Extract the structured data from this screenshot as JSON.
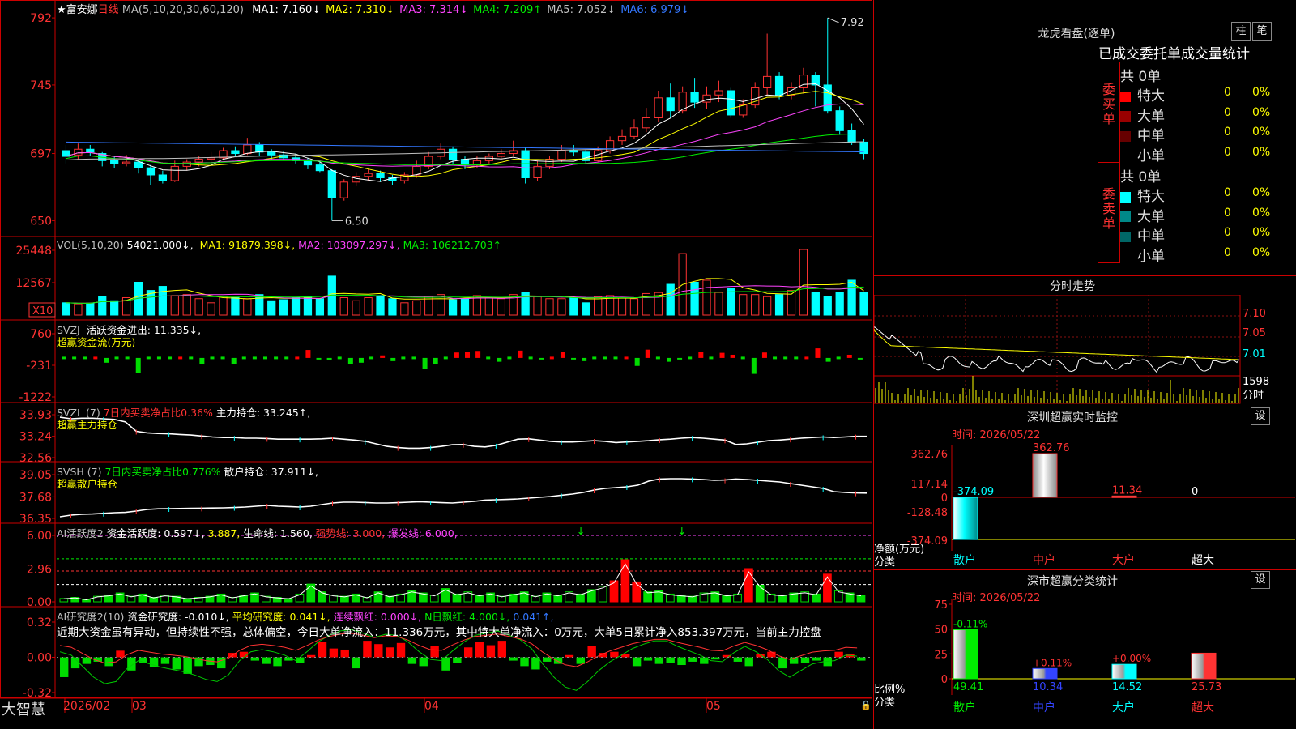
{
  "stock": {
    "name": "★富安娜",
    "period": "日线"
  },
  "colors": {
    "up": "#ff3333",
    "down": "#00ffff",
    "bg": "#000000",
    "frame": "#cc0000"
  },
  "main": {
    "ma_title": "MA(5,10,20,30,60,120)",
    "ma": [
      {
        "label": "MA1: 7.160↓",
        "color": "#ffffff"
      },
      {
        "label": "MA2: 7.310↓",
        "color": "#ffff00"
      },
      {
        "label": "MA3: 7.314↓",
        "color": "#ff44ff"
      },
      {
        "label": "MA4: 7.209↑",
        "color": "#00ee00"
      },
      {
        "label": "MA5: 7.052↓",
        "color": "#c0c0c0"
      },
      {
        "label": "MA6: 6.979↓",
        "color": "#3377ff"
      }
    ],
    "y_ticks": [
      "792",
      "745",
      "697",
      "650"
    ],
    "high_label": "7.92",
    "low_label": "6.50"
  },
  "candles": [
    {
      "o": 6.99,
      "c": 6.95,
      "h": 7.03,
      "l": 6.9
    },
    {
      "o": 6.96,
      "c": 7.0,
      "h": 7.04,
      "l": 6.93
    },
    {
      "o": 7.0,
      "c": 6.98,
      "h": 7.03,
      "l": 6.95
    },
    {
      "o": 6.97,
      "c": 6.92,
      "h": 6.98,
      "l": 6.88
    },
    {
      "o": 6.92,
      "c": 6.9,
      "h": 6.95,
      "l": 6.87
    },
    {
      "o": 6.9,
      "c": 6.91,
      "h": 6.96,
      "l": 6.88
    },
    {
      "o": 6.91,
      "c": 6.87,
      "h": 6.93,
      "l": 6.83
    },
    {
      "o": 6.87,
      "c": 6.82,
      "h": 6.89,
      "l": 6.75
    },
    {
      "o": 6.82,
      "c": 6.78,
      "h": 6.85,
      "l": 6.76
    },
    {
      "o": 6.78,
      "c": 6.88,
      "h": 6.92,
      "l": 6.77
    },
    {
      "o": 6.88,
      "c": 6.91,
      "h": 6.93,
      "l": 6.85
    },
    {
      "o": 6.91,
      "c": 6.93,
      "h": 6.95,
      "l": 6.88
    },
    {
      "o": 6.93,
      "c": 6.94,
      "h": 6.98,
      "l": 6.9
    },
    {
      "o": 6.94,
      "c": 6.99,
      "h": 7.01,
      "l": 6.93
    },
    {
      "o": 6.99,
      "c": 6.97,
      "h": 7.02,
      "l": 6.95
    },
    {
      "o": 6.97,
      "c": 7.03,
      "h": 7.08,
      "l": 6.96
    },
    {
      "o": 7.03,
      "c": 6.98,
      "h": 7.05,
      "l": 6.95
    },
    {
      "o": 6.98,
      "c": 6.96,
      "h": 7.0,
      "l": 6.93
    },
    {
      "o": 6.96,
      "c": 6.94,
      "h": 6.99,
      "l": 6.92
    },
    {
      "o": 6.94,
      "c": 6.92,
      "h": 6.97,
      "l": 6.9
    },
    {
      "o": 6.92,
      "c": 6.89,
      "h": 6.94,
      "l": 6.86
    },
    {
      "o": 6.89,
      "c": 6.85,
      "h": 6.91,
      "l": 6.84
    },
    {
      "o": 6.85,
      "c": 6.66,
      "h": 6.86,
      "l": 6.5
    },
    {
      "o": 6.66,
      "c": 6.77,
      "h": 6.79,
      "l": 6.64
    },
    {
      "o": 6.77,
      "c": 6.81,
      "h": 6.84,
      "l": 6.74
    },
    {
      "o": 6.81,
      "c": 6.83,
      "h": 6.86,
      "l": 6.78
    },
    {
      "o": 6.83,
      "c": 6.8,
      "h": 6.85,
      "l": 6.77
    },
    {
      "o": 6.8,
      "c": 6.78,
      "h": 6.82,
      "l": 6.75
    },
    {
      "o": 6.78,
      "c": 6.82,
      "h": 6.84,
      "l": 6.76
    },
    {
      "o": 6.82,
      "c": 6.88,
      "h": 6.92,
      "l": 6.8
    },
    {
      "o": 6.88,
      "c": 6.95,
      "h": 6.98,
      "l": 6.86
    },
    {
      "o": 6.95,
      "c": 7.0,
      "h": 7.04,
      "l": 6.93
    },
    {
      "o": 7.0,
      "c": 6.93,
      "h": 7.02,
      "l": 6.9
    },
    {
      "o": 6.93,
      "c": 6.89,
      "h": 6.95,
      "l": 6.86
    },
    {
      "o": 6.89,
      "c": 6.92,
      "h": 6.95,
      "l": 6.87
    },
    {
      "o": 6.92,
      "c": 6.95,
      "h": 6.97,
      "l": 6.9
    },
    {
      "o": 6.95,
      "c": 6.97,
      "h": 7.0,
      "l": 6.93
    },
    {
      "o": 6.97,
      "c": 6.99,
      "h": 7.06,
      "l": 6.95
    },
    {
      "o": 6.99,
      "c": 6.8,
      "h": 7.01,
      "l": 6.76
    },
    {
      "o": 6.8,
      "c": 6.88,
      "h": 6.92,
      "l": 6.78
    },
    {
      "o": 6.88,
      "c": 6.93,
      "h": 6.95,
      "l": 6.86
    },
    {
      "o": 6.93,
      "c": 6.99,
      "h": 7.03,
      "l": 6.91
    },
    {
      "o": 6.99,
      "c": 6.98,
      "h": 7.03,
      "l": 6.95
    },
    {
      "o": 6.98,
      "c": 6.92,
      "h": 7.0,
      "l": 6.9
    },
    {
      "o": 6.92,
      "c": 6.99,
      "h": 7.02,
      "l": 6.91
    },
    {
      "o": 6.99,
      "c": 7.06,
      "h": 7.09,
      "l": 6.97
    },
    {
      "o": 7.06,
      "c": 7.09,
      "h": 7.14,
      "l": 7.03
    },
    {
      "o": 7.09,
      "c": 7.15,
      "h": 7.21,
      "l": 7.07
    },
    {
      "o": 7.15,
      "c": 7.22,
      "h": 7.29,
      "l": 7.12
    },
    {
      "o": 7.22,
      "c": 7.36,
      "h": 7.41,
      "l": 7.19
    },
    {
      "o": 7.36,
      "c": 7.27,
      "h": 7.46,
      "l": 7.22
    },
    {
      "o": 7.27,
      "c": 7.4,
      "h": 7.44,
      "l": 7.25
    },
    {
      "o": 7.4,
      "c": 7.33,
      "h": 7.5,
      "l": 7.29
    },
    {
      "o": 7.33,
      "c": 7.38,
      "h": 7.44,
      "l": 7.28
    },
    {
      "o": 7.38,
      "c": 7.41,
      "h": 7.48,
      "l": 7.33
    },
    {
      "o": 7.41,
      "c": 7.24,
      "h": 7.43,
      "l": 7.22
    },
    {
      "o": 7.24,
      "c": 7.31,
      "h": 7.35,
      "l": 7.22
    },
    {
      "o": 7.31,
      "c": 7.43,
      "h": 7.47,
      "l": 7.29
    },
    {
      "o": 7.43,
      "c": 7.51,
      "h": 7.81,
      "l": 7.38
    },
    {
      "o": 7.51,
      "c": 7.38,
      "h": 7.54,
      "l": 7.35
    },
    {
      "o": 7.38,
      "c": 7.43,
      "h": 7.47,
      "l": 7.35
    },
    {
      "o": 7.43,
      "c": 7.52,
      "h": 7.57,
      "l": 7.39
    },
    {
      "o": 7.52,
      "c": 7.45,
      "h": 7.54,
      "l": 7.3
    },
    {
      "o": 7.45,
      "c": 7.27,
      "h": 7.92,
      "l": 7.25
    },
    {
      "o": 7.27,
      "c": 7.13,
      "h": 7.3,
      "l": 7.1
    },
    {
      "o": 7.13,
      "c": 7.05,
      "h": 7.18,
      "l": 7.03
    },
    {
      "o": 7.05,
      "c": 6.97,
      "h": 7.07,
      "l": 6.93
    }
  ],
  "vol": {
    "title": "VOL(5,10,20)",
    "cur": "54021.000↓,",
    "ma": [
      {
        "label": "MA1: 91879.398↓,",
        "color": "#ffff00"
      },
      {
        "label": "MA2: 103097.297↓,",
        "color": "#ff44ff"
      },
      {
        "label": "MA3: 106212.703↑",
        "color": "#00ee00"
      }
    ],
    "y_ticks": [
      "25448",
      "12567"
    ],
    "unit": "X10",
    "values": [
      60,
      55,
      58,
      90,
      70,
      85,
      160,
      120,
      140,
      95,
      100,
      80,
      60,
      90,
      85,
      80,
      100,
      70,
      75,
      85,
      90,
      80,
      190,
      85,
      70,
      85,
      95,
      80,
      60,
      70,
      90,
      100,
      75,
      80,
      95,
      85,
      80,
      100,
      110,
      90,
      80,
      80,
      85,
      60,
      90,
      95,
      85,
      80,
      105,
      110,
      150,
      300,
      160,
      170,
      110,
      130,
      100,
      100,
      90,
      100,
      120,
      320,
      110,
      90,
      110,
      170,
      110,
      95,
      80,
      70
    ]
  },
  "svzj": {
    "title": "SVZJ",
    "line1": "活跃资金进出: 11.335↓,",
    "line2": "超赢资金流(万元)",
    "y_ticks": [
      "760",
      "-231",
      "-1222"
    ],
    "values": [
      -30,
      -20,
      -40,
      20,
      -150,
      -20,
      -30,
      -480,
      -20,
      -30,
      -40,
      10,
      -30,
      -200,
      -20,
      -30,
      -180,
      -20,
      -30,
      -20,
      -40,
      -20,
      20,
      250,
      -50,
      -60,
      -20,
      -200,
      -150,
      -30,
      80,
      -100,
      -40,
      -30,
      -350,
      -200,
      -30,
      170,
      180,
      220,
      -30,
      -120,
      -40,
      230,
      -30,
      -50,
      40,
      190,
      -50,
      -100,
      -30,
      -40,
      -20,
      40,
      -250,
      260,
      -30,
      -120,
      -50,
      -30,
      180,
      -30,
      160,
      100,
      -30,
      -500,
      170,
      -30,
      -40,
      -20,
      30,
      300,
      -120,
      -10,
      100,
      -50
    ]
  },
  "svzl": {
    "title": "SVZL (7)",
    "ratio": "7日内买卖净占比0.36%",
    "hold": "主力持仓: 33.245↑,",
    "line2": "超赢主力持仓",
    "y_ticks": [
      "33.93",
      "33.24",
      "32.56"
    ],
    "values": [
      33.85,
      33.8,
      33.82,
      33.82,
      33.8,
      33.78,
      33.7,
      33.4,
      33.35,
      33.33,
      33.32,
      33.3,
      33.28,
      33.25,
      33.22,
      33.2,
      33.2,
      33.18,
      33.18,
      33.17,
      33.15,
      33.15,
      33.15,
      33.15,
      33.16,
      33.18,
      33.15,
      33.12,
      33.08,
      33.0,
      32.92,
      32.88,
      32.86,
      32.86,
      32.88,
      32.92,
      32.97,
      32.98,
      32.92,
      32.9,
      32.95,
      33.05,
      33.15,
      33.16,
      33.12,
      33.08,
      33.06,
      33.06,
      33.08,
      33.1,
      33.08,
      33.04,
      33.06,
      33.08,
      33.1,
      33.13,
      33.15,
      33.18,
      33.2,
      33.18,
      33.15,
      33.12,
      32.98,
      33.0,
      33.05,
      33.1,
      33.12,
      33.15,
      33.18,
      33.2,
      33.22,
      33.2,
      33.22,
      33.24,
      33.24
    ]
  },
  "svsh": {
    "title": "SVSH (7)",
    "ratio": "7日内买卖净占比0.776%",
    "hold": "散户持仓: 37.911↓,",
    "line2": "超赢散户持仓",
    "y_ticks": [
      "39.05",
      "37.68",
      "36.35"
    ],
    "values": [
      36.45,
      36.55,
      36.6,
      36.62,
      36.66,
      36.7,
      36.72,
      36.8,
      36.9,
      36.94,
      36.95,
      36.96,
      36.97,
      36.98,
      36.99,
      37.0,
      37.02,
      37.05,
      37.1,
      37.15,
      37.1,
      37.08,
      37.05,
      37.1,
      37.2,
      37.3,
      37.35,
      37.35,
      37.33,
      37.3,
      37.3,
      37.32,
      37.35,
      37.38,
      37.35,
      37.32,
      37.3,
      37.35,
      37.4,
      37.48,
      37.5,
      37.52,
      37.55,
      37.6,
      37.65,
      37.7,
      37.78,
      37.85,
      37.95,
      38.1,
      38.2,
      38.25,
      38.3,
      38.4,
      38.65,
      38.78,
      38.8,
      38.8,
      38.78,
      38.75,
      38.7,
      38.72,
      38.78,
      38.75,
      38.7,
      38.65,
      38.6,
      38.5,
      38.4,
      38.3,
      38.2,
      38.0,
      37.95,
      37.92,
      37.91
    ]
  },
  "ai1": {
    "title": "AI活跃度2",
    "a": "资金活跃度: 0.597↓,",
    "b": "3.887,",
    "c": "生命线: 1.560,",
    "d": "强势线: 3.000,",
    "e": "爆发线: 6.000,",
    "y_ticks": [
      "6.00",
      "2.96",
      "0.00"
    ],
    "values": [
      0.3,
      0.4,
      0.2,
      0.5,
      0.6,
      0.8,
      0.5,
      0.7,
      0.4,
      0.6,
      0.5,
      0.3,
      0.4,
      0.5,
      0.7,
      0.4,
      0.6,
      0.8,
      0.5,
      0.4,
      0.3,
      0.7,
      1.6,
      0.9,
      0.6,
      0.5,
      0.7,
      0.4,
      0.9,
      0.5,
      0.7,
      1.0,
      0.8,
      0.6,
      1.2,
      0.7,
      0.9,
      0.6,
      0.8,
      0.5,
      0.7,
      0.9,
      0.5,
      0.8,
      0.6,
      0.9,
      0.7,
      1.1,
      1.4,
      1.9,
      3.8,
      1.8,
      0.9,
      1.0,
      0.7,
      0.6,
      0.5,
      0.8,
      0.9,
      0.6,
      0.7,
      3.0,
      1.5,
      0.7,
      0.6,
      0.8,
      0.9,
      0.7,
      2.5,
      1.0,
      0.8,
      0.6
    ],
    "arrows": [
      46,
      55
    ]
  },
  "ai2": {
    "title": "AI研究度2(10)",
    "a": "资金研究度: -0.010↓,",
    "b": "平均研究度: 0.041↓,",
    "c": "连续飘红: 0.000↓,",
    "d": "N日飘红: 4.000↓,",
    "e": "0.041↑,",
    "comment": "近期大资金虽有异动，但持续性不强，总体偏空，今日大单净流入：11.336万元，其中特大单净流入：0万元，大单5日累计净入853.397万元，当前主力控盘",
    "y_ticks": [
      "0.32",
      "0.00",
      "-0.32"
    ],
    "values": [
      -0.18,
      -0.1,
      -0.06,
      -0.04,
      -0.08,
      0.06,
      -0.12,
      -0.05,
      -0.09,
      -0.06,
      -0.11,
      -0.15,
      -0.08,
      -0.07,
      -0.1,
      0.04,
      0.05,
      -0.03,
      -0.06,
      -0.08,
      -0.03,
      -0.05,
      0.02,
      0.14,
      0.08,
      0.07,
      -0.1,
      0.15,
      0.12,
      0.09,
      0.13,
      -0.06,
      -0.08,
      0.1,
      -0.12,
      -0.05,
      0.09,
      0.14,
      0.11,
      0.15,
      -0.03,
      -0.08,
      -0.11,
      -0.04,
      -0.06,
      0.02,
      -0.06,
      0.1,
      0.04,
      0.05,
      0.03,
      -0.08,
      -0.03,
      -0.06,
      -0.05,
      -0.07,
      -0.04,
      -0.06,
      -0.02,
      0.02,
      -0.04,
      -0.08,
      0.03,
      0.05,
      -0.1,
      -0.06,
      -0.05,
      -0.03,
      -0.08,
      0.05,
      0.03,
      -0.03
    ],
    "line": [
      0.05,
      0.02,
      -0.08,
      -0.18,
      -0.24,
      -0.22,
      -0.1,
      -0.03,
      -0.06,
      -0.09,
      -0.11,
      -0.13,
      -0.16,
      -0.2,
      -0.22,
      -0.16,
      -0.03,
      0.05,
      0.07,
      0.05,
      0.02,
      -0.03,
      0.05,
      0.14,
      0.2,
      0.24,
      0.25,
      0.22,
      0.18,
      0.21,
      0.2,
      0.14,
      0.05,
      -0.02,
      -0.03,
      0.06,
      0.14,
      0.2,
      0.22,
      0.24,
      0.2,
      0.16,
      0.08,
      -0.06,
      -0.18,
      -0.27,
      -0.3,
      -0.22,
      -0.12,
      -0.04,
      0.02,
      0.08,
      0.12,
      0.15,
      0.15,
      0.1,
      0.06,
      0.02,
      -0.03,
      -0.04,
      0.04,
      0.1,
      0.05,
      -0.02,
      -0.12,
      -0.18,
      -0.12,
      -0.06,
      -0.04,
      -0.03,
      0.02,
      0.01
    ]
  },
  "bottom": {
    "brand": "大智慧",
    "dates": [
      "2026/02",
      "03",
      "04",
      "05"
    ]
  },
  "side": {
    "lhb_title": "龙虎看盘(逐单)",
    "btn_col": "柱",
    "btn_pen": "笔",
    "stat_title": "已成交委托单成交量统计",
    "buy_group": "委买单",
    "sell_group": "委卖单",
    "buy_total": "共 0单",
    "sell_total": "共 0单",
    "buy_rows": [
      {
        "label": "特大",
        "count": "0",
        "pct": "0%",
        "color": "#ff0000"
      },
      {
        "label": "大单",
        "count": "0",
        "pct": "0%",
        "color": "#990000"
      },
      {
        "label": "中单",
        "count": "0",
        "pct": "0%",
        "color": "#660000"
      },
      {
        "label": "小单",
        "count": "0",
        "pct": "0%",
        "color": ""
      }
    ],
    "sell_rows": [
      {
        "label": "特大",
        "count": "0",
        "pct": "0%",
        "color": "#00ffff"
      },
      {
        "label": "大单",
        "count": "0",
        "pct": "0%",
        "color": "#008888"
      },
      {
        "label": "中单",
        "count": "0",
        "pct": "0%",
        "color": "#006666"
      },
      {
        "label": "小单",
        "count": "0",
        "pct": "0%",
        "color": ""
      }
    ],
    "intraday_title": "分时走势",
    "intraday_ticks": [
      "7.10",
      "7.05",
      "7.01",
      "1598",
      "分时"
    ],
    "monitor_title": "深圳超赢实时监控",
    "monitor_btn": "设",
    "monitor_time": "时间: 2026/05/22",
    "monitor_y": [
      "362.76",
      "117.14",
      "0",
      "-128.48",
      "-374.09"
    ],
    "monitor_unit_1": "净额(万元)",
    "monitor_unit_2": "分类",
    "monitor_cats": [
      "散户",
      "中户",
      "大户",
      "超大"
    ],
    "monitor_vals": [
      "-374.09",
      "362.76",
      "11.34",
      "0"
    ],
    "monitor_values": [
      -374.09,
      362.76,
      11.34,
      0
    ],
    "cls_title": "深市超赢分类统计",
    "cls_btn": "设",
    "cls_time": "时间: 2026/05/22",
    "cls_y": [
      "75",
      "50",
      "25",
      "0"
    ],
    "cls_unit_1": "比例%",
    "cls_unit_2": "分类",
    "cls_cats": [
      "散户",
      "中户",
      "大户",
      "超大"
    ],
    "cls_vals": [
      "49.41",
      "10.34",
      "14.52",
      "25.73"
    ],
    "cls_values": [
      49.41,
      10.34,
      14.52,
      25.73
    ],
    "cls_delta": [
      "-0.11%",
      "+0.11%",
      "+0.00%",
      ""
    ]
  }
}
